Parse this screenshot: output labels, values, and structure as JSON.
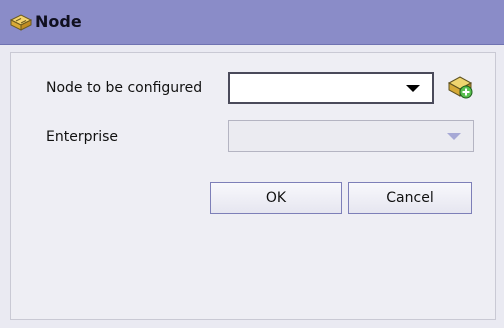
{
  "window": {
    "title": "Node",
    "title_icon": "node-icon"
  },
  "form": {
    "node_label": "Node to be configured",
    "node_value": "",
    "node_picker_icon": "node-picker-icon",
    "enterprise_label": "Enterprise",
    "enterprise_value": ""
  },
  "buttons": {
    "ok_label": "OK",
    "cancel_label": "Cancel"
  },
  "colors": {
    "titlebar": "#8a8cc8",
    "dialog_bg": "#eaeaf2",
    "disabled_arrow": "#a7a9d6"
  }
}
